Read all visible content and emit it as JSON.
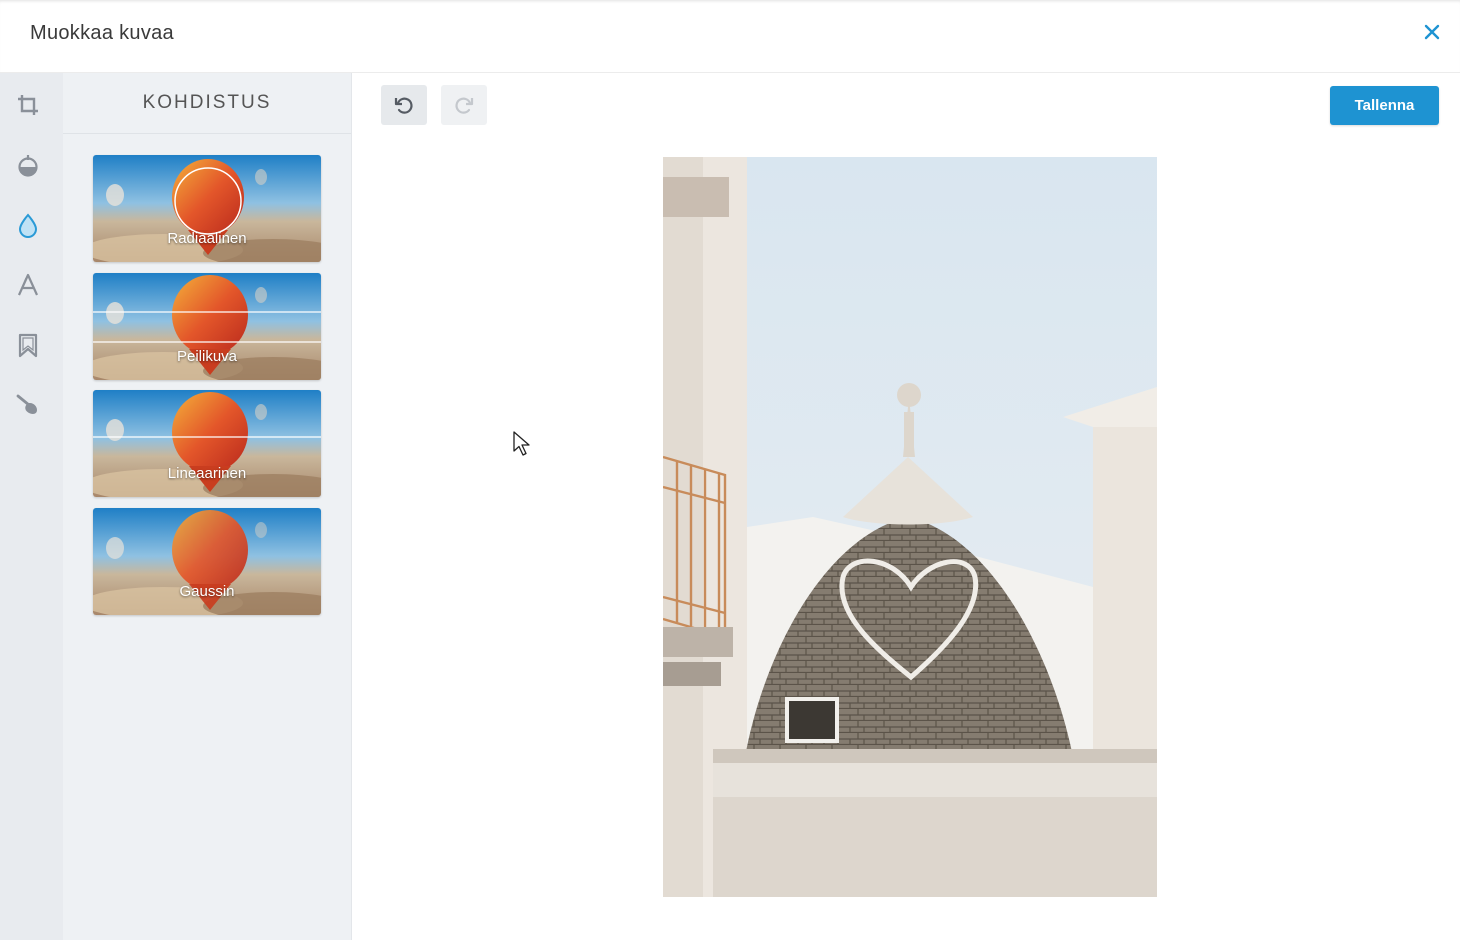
{
  "window": {
    "title": "Muokkaa kuvaa",
    "close_icon": "close-icon"
  },
  "toolbar": {
    "tools": [
      {
        "name": "crop-icon",
        "active": false
      },
      {
        "name": "adjust-icon",
        "active": false
      },
      {
        "name": "focus-drop-icon",
        "active": true
      },
      {
        "name": "text-icon",
        "active": false
      },
      {
        "name": "bookmark-icon",
        "active": false
      },
      {
        "name": "brush-icon",
        "active": false
      }
    ]
  },
  "panel": {
    "title": "KOHDISTUS",
    "options": [
      {
        "label": "Radiaalinen",
        "overlay": "circle"
      },
      {
        "label": "Peilikuva",
        "overlay": "mirror"
      },
      {
        "label": "Lineaarinen",
        "overlay": "line"
      },
      {
        "label": "Gaussin",
        "overlay": "none"
      }
    ]
  },
  "history": {
    "undo_icon": "undo-icon",
    "redo_icon": "redo-icon",
    "redo_enabled": false
  },
  "actions": {
    "save_label": "Tallenna"
  },
  "colors": {
    "accent": "#1e93d2",
    "active_tool": "#2a9ad6",
    "inactive_tool": "#8a9099"
  }
}
